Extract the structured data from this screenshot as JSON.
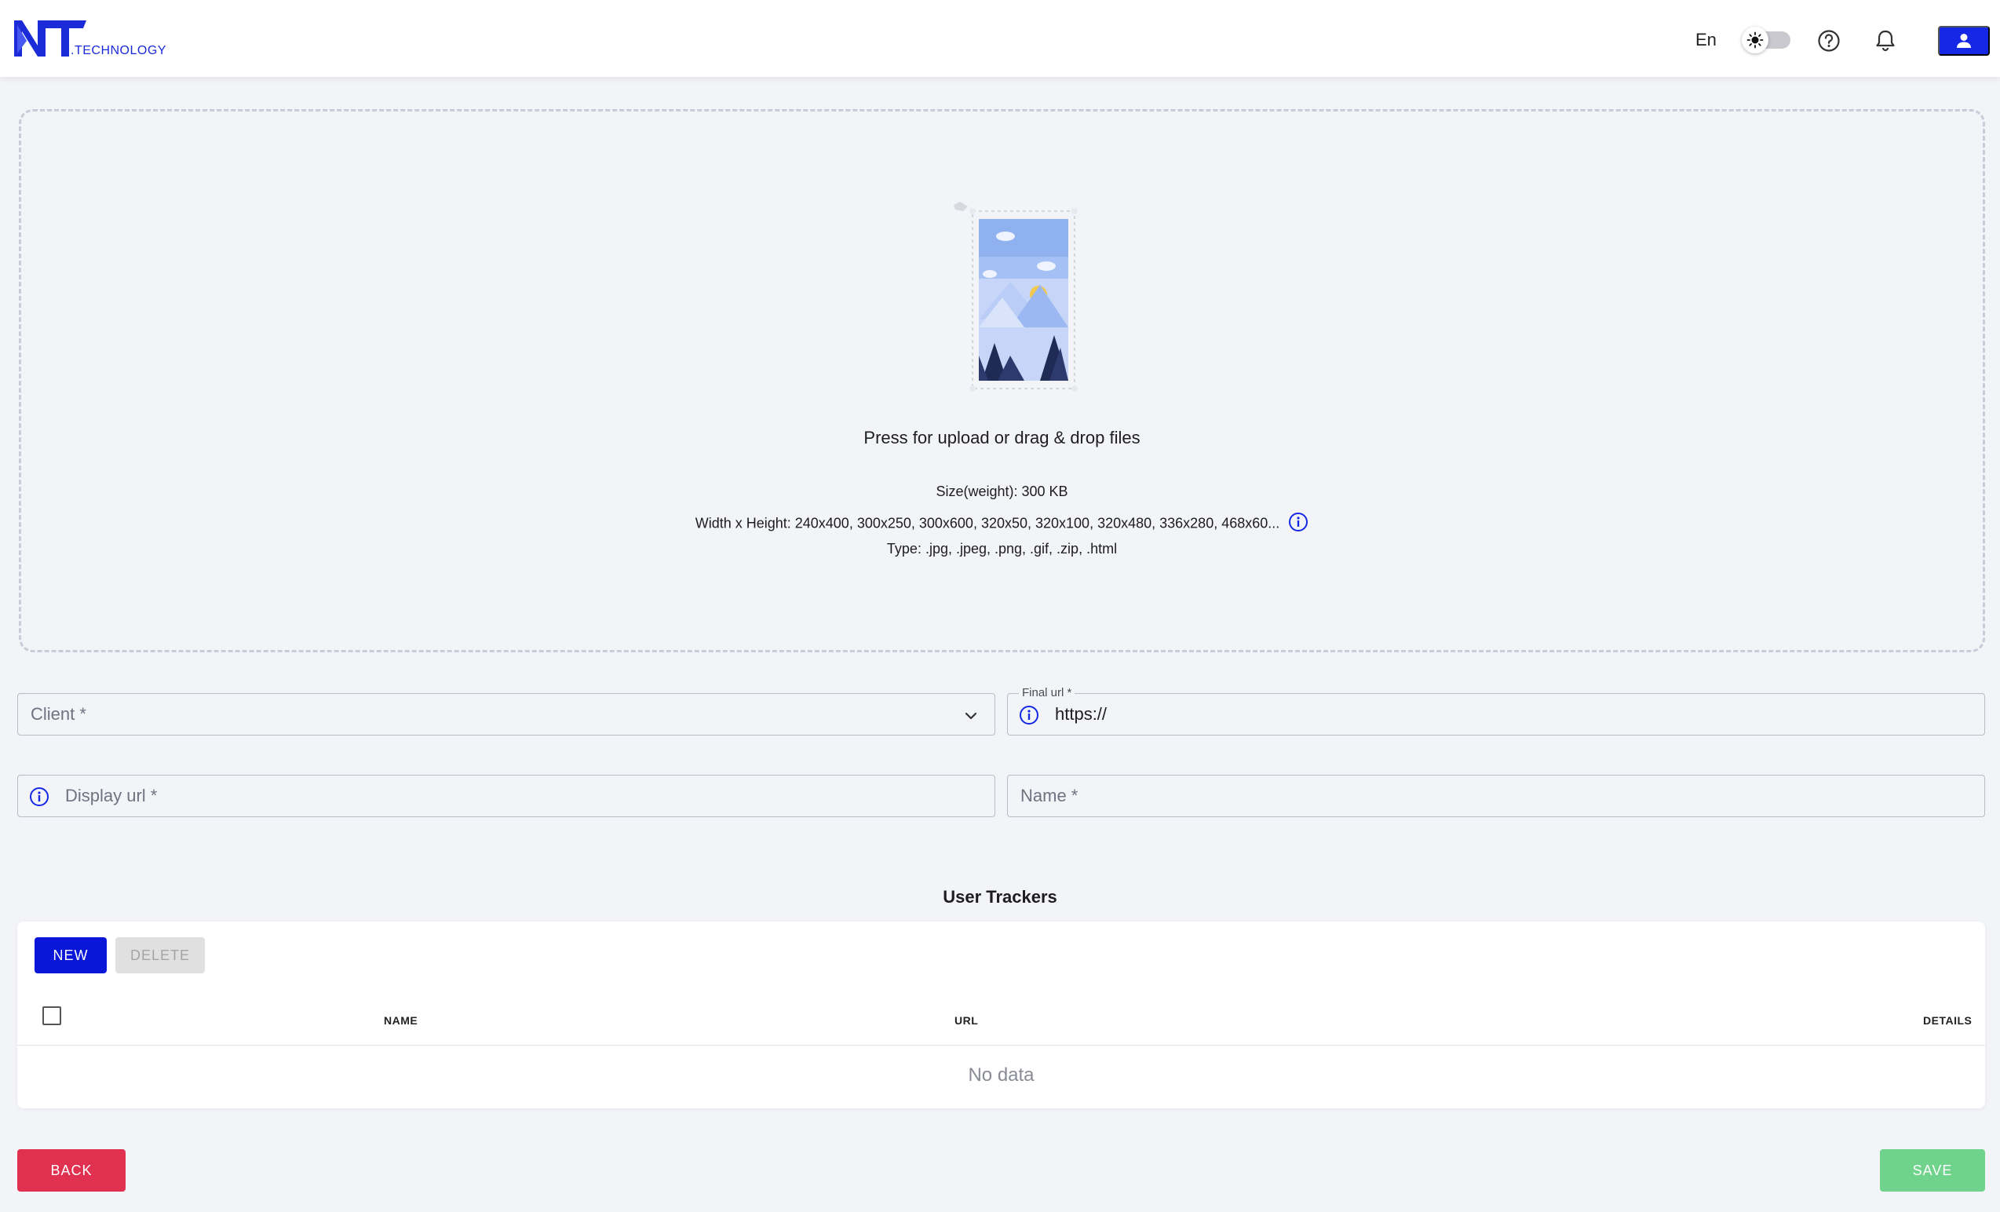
{
  "header": {
    "logo_text": ".TECHNOLOGY",
    "language": "En",
    "theme_toggle_on": false
  },
  "upload": {
    "title": "Press for upload or drag & drop files",
    "size": "Size(weight): 300 KB",
    "dimensions": "Width x Height: 240x400, 300x250, 300x600, 320x50, 320x100, 320x480, 336x280, 468x60...",
    "types": "Type: .jpg, .jpeg, .png, .gif, .zip, .html"
  },
  "form": {
    "client_placeholder": "Client *",
    "final_url_label": "Final url *",
    "final_url_value": "https://",
    "display_url_placeholder": "Display url *",
    "name_placeholder": "Name *"
  },
  "trackers": {
    "title": "User Trackers",
    "new_label": "NEW",
    "delete_label": "DELETE",
    "columns": [
      "NAME",
      "URL",
      "DETAILS"
    ],
    "empty_text": "No data"
  },
  "footer": {
    "back_label": "BACK",
    "save_label": "SAVE"
  },
  "colors": {
    "primary": "#0a16d8",
    "danger": "#e03150",
    "success": "#6fd38c",
    "logo": "#1b2bd8"
  }
}
